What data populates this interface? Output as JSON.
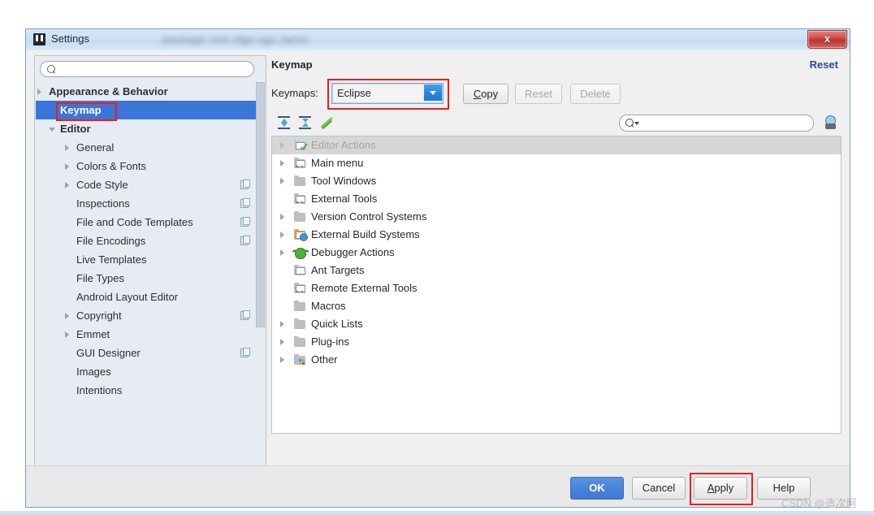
{
  "window": {
    "title": "Settings",
    "title_blur_text": "package com.cfgo.cgo.Jamo;",
    "close_label": "x",
    "icon": "settings-window-icon"
  },
  "sidebar": {
    "search": {
      "value": "",
      "placeholder": "",
      "icon": "search-icon"
    },
    "items": [
      {
        "label": "Appearance & Behavior",
        "indent": 16,
        "arrow": "collapsed",
        "bold": true,
        "selected": false,
        "copy_icon": false
      },
      {
        "label": "Keymap",
        "indent": 30,
        "arrow": "none",
        "bold": true,
        "selected": true,
        "copy_icon": false
      },
      {
        "label": "Editor",
        "indent": 30,
        "arrow": "expanded",
        "bold": true,
        "selected": false,
        "copy_icon": false
      },
      {
        "label": "General",
        "indent": 50,
        "arrow": "collapsed",
        "bold": false,
        "selected": false,
        "copy_icon": false
      },
      {
        "label": "Colors & Fonts",
        "indent": 50,
        "arrow": "collapsed",
        "bold": false,
        "selected": false,
        "copy_icon": false
      },
      {
        "label": "Code Style",
        "indent": 50,
        "arrow": "collapsed",
        "bold": false,
        "selected": false,
        "copy_icon": true
      },
      {
        "label": "Inspections",
        "indent": 50,
        "arrow": "none",
        "bold": false,
        "selected": false,
        "copy_icon": true
      },
      {
        "label": "File and Code Templates",
        "indent": 50,
        "arrow": "none",
        "bold": false,
        "selected": false,
        "copy_icon": true
      },
      {
        "label": "File Encodings",
        "indent": 50,
        "arrow": "none",
        "bold": false,
        "selected": false,
        "copy_icon": true
      },
      {
        "label": "Live Templates",
        "indent": 50,
        "arrow": "none",
        "bold": false,
        "selected": false,
        "copy_icon": false
      },
      {
        "label": "File Types",
        "indent": 50,
        "arrow": "none",
        "bold": false,
        "selected": false,
        "copy_icon": false
      },
      {
        "label": "Android Layout Editor",
        "indent": 50,
        "arrow": "none",
        "bold": false,
        "selected": false,
        "copy_icon": false
      },
      {
        "label": "Copyright",
        "indent": 50,
        "arrow": "collapsed",
        "bold": false,
        "selected": false,
        "copy_icon": true
      },
      {
        "label": "Emmet",
        "indent": 50,
        "arrow": "collapsed",
        "bold": false,
        "selected": false,
        "copy_icon": false
      },
      {
        "label": "GUI Designer",
        "indent": 50,
        "arrow": "none",
        "bold": false,
        "selected": false,
        "copy_icon": true
      },
      {
        "label": "Images",
        "indent": 50,
        "arrow": "none",
        "bold": false,
        "selected": false,
        "copy_icon": false
      },
      {
        "label": "Intentions",
        "indent": 50,
        "arrow": "none",
        "bold": false,
        "selected": false,
        "copy_icon": false
      }
    ]
  },
  "main": {
    "title": "Keymap",
    "reset_link": "Reset",
    "keymaps_label": "Keymaps:",
    "keymap_selected": "Eclipse",
    "buttons": [
      {
        "label": "Copy",
        "mnemonic": "C",
        "enabled": true
      },
      {
        "label": "Reset",
        "mnemonic": "",
        "enabled": false
      },
      {
        "label": "Delete",
        "mnemonic": "",
        "enabled": false
      }
    ],
    "toolbar": {
      "expand_all": "expand-all-icon",
      "collapse_all": "collapse-all-icon",
      "edit_shortcut": "edit-pencil-icon",
      "search": {
        "value": "",
        "placeholder": "",
        "icon": "search-icon"
      },
      "find_by_shortcut": "find-by-shortcut-icon"
    },
    "tree": [
      {
        "label": "Editor Actions",
        "arrow": "collapsed",
        "icon": "window-green-check-folder-icon",
        "selected": true
      },
      {
        "label": "Main menu",
        "arrow": "collapsed",
        "icon": "window-dots-folder-icon",
        "selected": false
      },
      {
        "label": "Tool Windows",
        "arrow": "collapsed",
        "icon": "folder-icon",
        "selected": false
      },
      {
        "label": "External Tools",
        "arrow": "none",
        "icon": "window-dots-folder-icon",
        "selected": false
      },
      {
        "label": "Version Control Systems",
        "arrow": "collapsed",
        "icon": "folder-icon",
        "selected": false
      },
      {
        "label": "External Build Systems",
        "arrow": "collapsed",
        "icon": "folder-gear-icon",
        "selected": false
      },
      {
        "label": "Debugger Actions",
        "arrow": "collapsed",
        "icon": "bug-icon",
        "selected": false
      },
      {
        "label": "Ant Targets",
        "arrow": "none",
        "icon": "window-folder-icon",
        "selected": false
      },
      {
        "label": "Remote External Tools",
        "arrow": "none",
        "icon": "window-dots-folder-icon",
        "selected": false
      },
      {
        "label": "Macros",
        "arrow": "none",
        "icon": "folder-icon",
        "selected": false
      },
      {
        "label": "Quick Lists",
        "arrow": "collapsed",
        "icon": "folder-icon",
        "selected": false
      },
      {
        "label": "Plug-ins",
        "arrow": "collapsed",
        "icon": "folder-icon",
        "selected": false
      },
      {
        "label": "Other",
        "arrow": "collapsed",
        "icon": "tiles-folder-icon",
        "selected": false
      }
    ]
  },
  "footer": {
    "ok": "OK",
    "cancel": "Cancel",
    "apply": "Apply",
    "apply_mnemonic": "A",
    "help": "Help"
  },
  "watermark": "CSDN @造次阿",
  "colors": {
    "selection_blue": "#3a76d8",
    "annotation_red": "#ef1b1b",
    "link_blue": "#2a4a9c",
    "primary_button": "#4a84d8",
    "tree_selected_gray": "#d6d6d6"
  }
}
